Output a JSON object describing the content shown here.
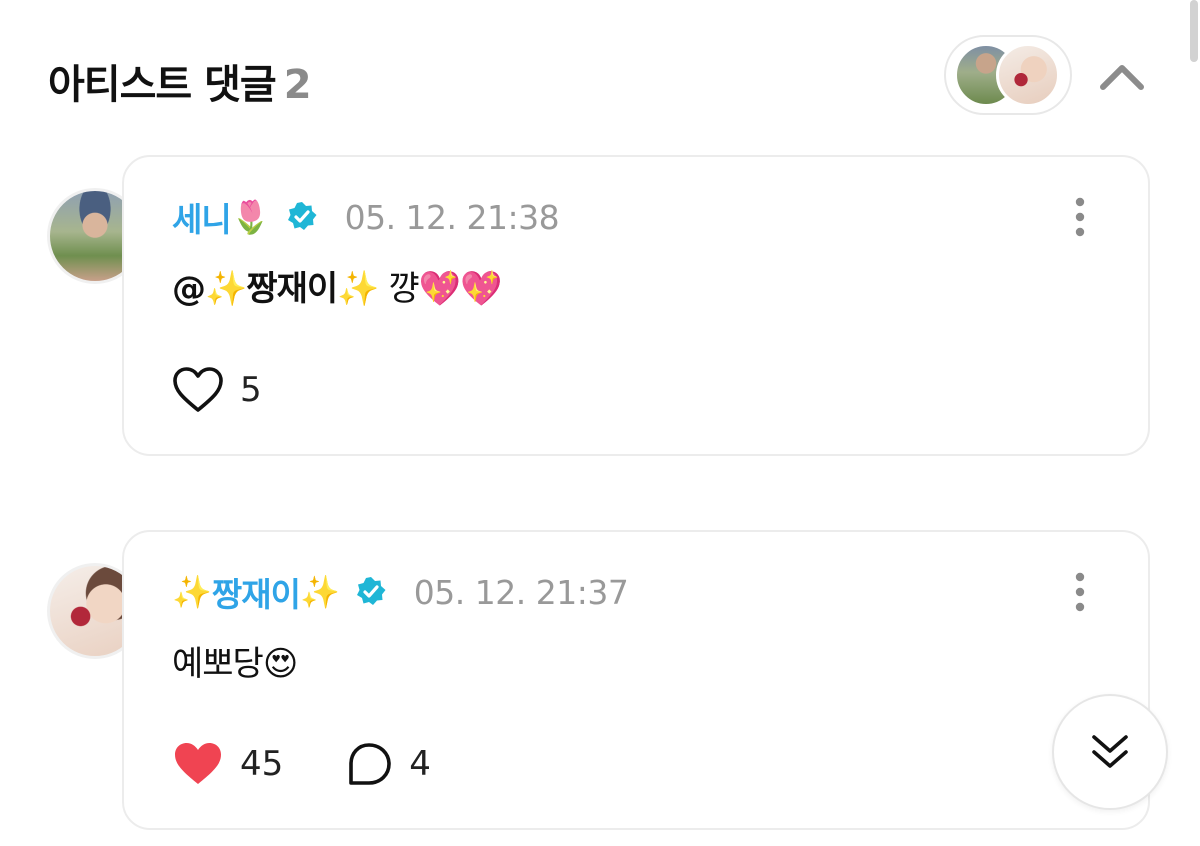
{
  "header": {
    "title": "아티스트 댓글",
    "count": "2"
  },
  "comments": [
    {
      "author": "세니",
      "author_emoji": "🌷",
      "timestamp": "05. 12. 21:38",
      "mention_prefix": "@✨",
      "mention_name": "짱재이",
      "mention_suffix": "✨",
      "text": " 꺙💖💖",
      "liked": false,
      "like_count": "5"
    },
    {
      "author_prefix": "✨",
      "author": "짱재이",
      "author_suffix": "✨",
      "timestamp": "05. 12. 21:37",
      "text": "예뽀당😍",
      "liked": true,
      "like_count": "45",
      "reply_count": "4"
    }
  ],
  "colors": {
    "accent": "#2fa4e7",
    "verified": "#1fb6d6",
    "like_active": "#f04452",
    "muted": "#999999"
  },
  "icons": [
    "chevron-up-icon",
    "verified-badge-icon",
    "more-vertical-icon",
    "heart-icon",
    "heart-filled-icon",
    "comment-bubble-icon",
    "double-chevron-down-icon"
  ]
}
